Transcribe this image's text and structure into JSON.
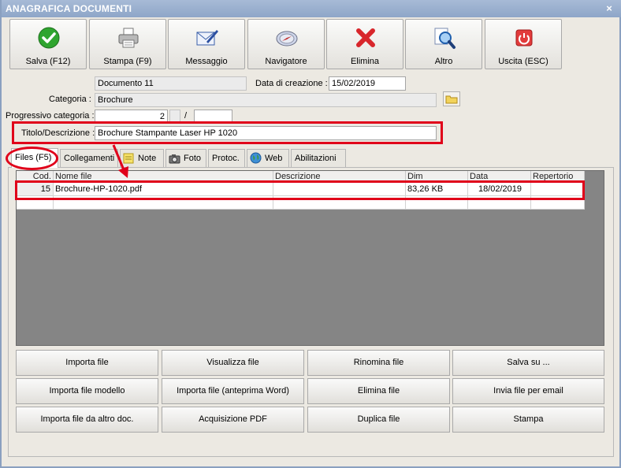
{
  "window": {
    "title": "ANAGRAFICA DOCUMENTI",
    "close_glyph": "×"
  },
  "toolbar": {
    "buttons": [
      {
        "label": "Salva (F12)",
        "icon": "check-icon"
      },
      {
        "label": "Stampa (F9)",
        "icon": "printer-icon"
      },
      {
        "label": "Messaggio",
        "icon": "envelope-pen-icon"
      },
      {
        "label": "Navigatore",
        "icon": "compass-icon"
      },
      {
        "label": "Elimina",
        "icon": "delete-x-icon"
      },
      {
        "label": "Altro",
        "icon": "magnifier-icon"
      },
      {
        "label": "Uscita (ESC)",
        "icon": "power-icon"
      }
    ]
  },
  "form": {
    "documento_value": "Documento 11",
    "data_creazione_label": "Data di creazione :",
    "data_creazione_value": "15/02/2019",
    "categoria_label": "Categoria :",
    "categoria_value": "Brochure",
    "progressivo_label": "Progressivo categoria :",
    "progressivo_value": "2",
    "progressivo_sep": "/",
    "progressivo_total": "",
    "titolo_label": "Titolo/Descrizione :",
    "titolo_value": "Brochure Stampante Laser HP 1020"
  },
  "tabs": [
    {
      "label": "Files (F5)"
    },
    {
      "label": "Collegamenti"
    },
    {
      "label": "Note"
    },
    {
      "label": "Foto"
    },
    {
      "label": "Protoc."
    },
    {
      "label": "Web"
    },
    {
      "label": "Abilitazioni"
    }
  ],
  "files_table": {
    "columns": [
      "Cod.",
      "Nome file",
      "Descrizione",
      "Dim",
      "Data",
      "Repertorio"
    ],
    "rows": [
      {
        "cod": "15",
        "nome": "Brochure-HP-1020.pdf",
        "descrizione": "",
        "dim": "83,26 KB",
        "data": "18/02/2019",
        "repertorio": ""
      }
    ]
  },
  "actions": {
    "importa_file": "Importa file",
    "visualizza_file": "Visualizza file",
    "rinomina_file": "Rinomina file",
    "salva_su": "Salva su ...",
    "importa_file_modello": "Importa file modello",
    "importa_file_anteprima": "Importa file (anteprima Word)",
    "elimina_file": "Elimina file",
    "invia_file_email": "Invia file per email",
    "importa_file_altro": "Importa file da altro doc.",
    "acquisizione_pdf": "Acquisizione PDF",
    "duplica_file": "Duplica file",
    "stampa": "Stampa"
  },
  "colors": {
    "annotation_red": "#e0001a",
    "titlebar": "#9bb0cf",
    "grid_empty": "#858585"
  }
}
